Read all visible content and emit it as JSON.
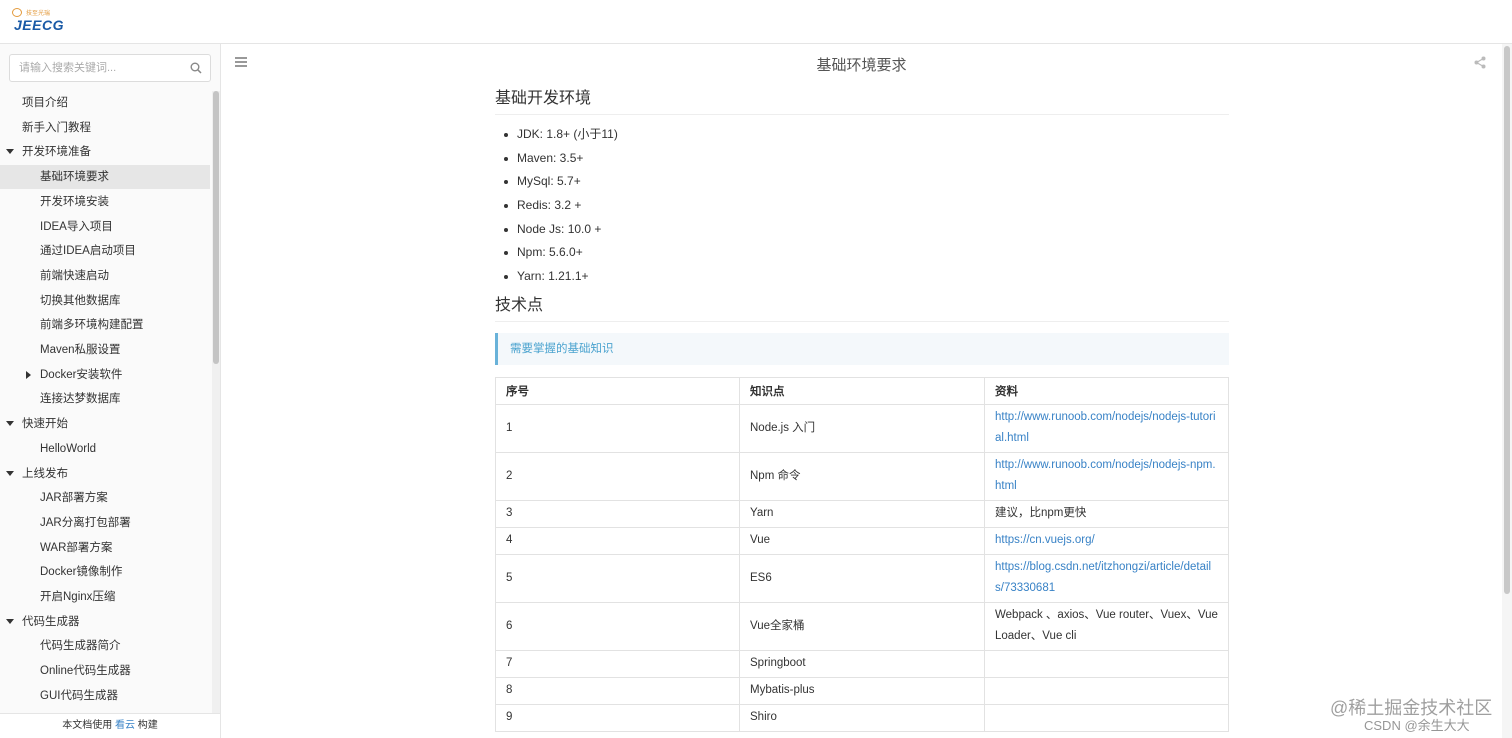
{
  "logo": {
    "small_text": "技至光瑞",
    "main_text": "JEECG"
  },
  "search": {
    "placeholder": "请输入搜索关键词..."
  },
  "nav": [
    {
      "label": "项目介绍"
    },
    {
      "label": "新手入门教程"
    },
    {
      "label": "开发环境准备",
      "expanded": true
    },
    {
      "label": "基础环境要求",
      "active": true
    },
    {
      "label": "开发环境安装"
    },
    {
      "label": "IDEA导入项目"
    },
    {
      "label": "通过IDEA启动项目"
    },
    {
      "label": "前端快速启动"
    },
    {
      "label": "切换其他数据库"
    },
    {
      "label": "前端多环境构建配置"
    },
    {
      "label": "Maven私服设置"
    },
    {
      "label": "Docker安装软件",
      "collapsed": true
    },
    {
      "label": "连接达梦数据库"
    },
    {
      "label": "快速开始",
      "expanded": true
    },
    {
      "label": "HelloWorld"
    },
    {
      "label": "上线发布",
      "expanded": true
    },
    {
      "label": "JAR部署方案"
    },
    {
      "label": "JAR分离打包部署"
    },
    {
      "label": "WAR部署方案"
    },
    {
      "label": "Docker镜像制作"
    },
    {
      "label": "开启Nginx压缩"
    },
    {
      "label": "代码生成器",
      "expanded": true
    },
    {
      "label": "代码生成器简介"
    },
    {
      "label": "Online代码生成器"
    },
    {
      "label": "GUI代码生成器"
    }
  ],
  "footer": {
    "prefix": "本文档使用 ",
    "link": "看云",
    "suffix": " 构建"
  },
  "page_title": "基础环境要求",
  "section1": {
    "title": "基础开发环境",
    "items": [
      "JDK: 1.8+ (小于11)",
      "Maven: 3.5+",
      "MySql: 5.7+",
      "Redis: 3.2 +",
      "Node Js: 10.0 +",
      "Npm: 5.6.0+",
      "Yarn: 1.21.1+"
    ]
  },
  "section2": {
    "title": "技术点",
    "note": "需要掌握的基础知识",
    "headers": [
      "序号",
      "知识点",
      "资料"
    ],
    "rows": [
      {
        "no": "1",
        "topic": "Node.js 入门",
        "ref": "http://www.runoob.com/nodejs/nodejs-tutorial.html",
        "link": true
      },
      {
        "no": "2",
        "topic": "Npm 命令",
        "ref": "http://www.runoob.com/nodejs/nodejs-npm.html",
        "link": true
      },
      {
        "no": "3",
        "topic": "Yarn",
        "ref": "建议，比npm更快",
        "link": false
      },
      {
        "no": "4",
        "topic": "Vue",
        "ref": "https://cn.vuejs.org/",
        "link": true
      },
      {
        "no": "5",
        "topic": "ES6",
        "ref": "https://blog.csdn.net/itzhongzi/article/details/73330681",
        "link": true
      },
      {
        "no": "6",
        "topic": "Vue全家桶",
        "ref": "Webpack 、axios、Vue router、Vuex、Vue Loader、Vue cli",
        "link": false
      },
      {
        "no": "7",
        "topic": "Springboot",
        "ref": "",
        "link": false
      },
      {
        "no": "8",
        "topic": "Mybatis-plus",
        "ref": "",
        "link": false
      },
      {
        "no": "9",
        "topic": "Shiro",
        "ref": "",
        "link": false
      }
    ]
  },
  "watermark": {
    "line1": "@稀土掘金技术社区",
    "line2": "CSDN @余生大大"
  },
  "colors": {
    "link": "#3882c6",
    "note_border": "#69b2d9",
    "note_text": "#4ba3cf"
  }
}
